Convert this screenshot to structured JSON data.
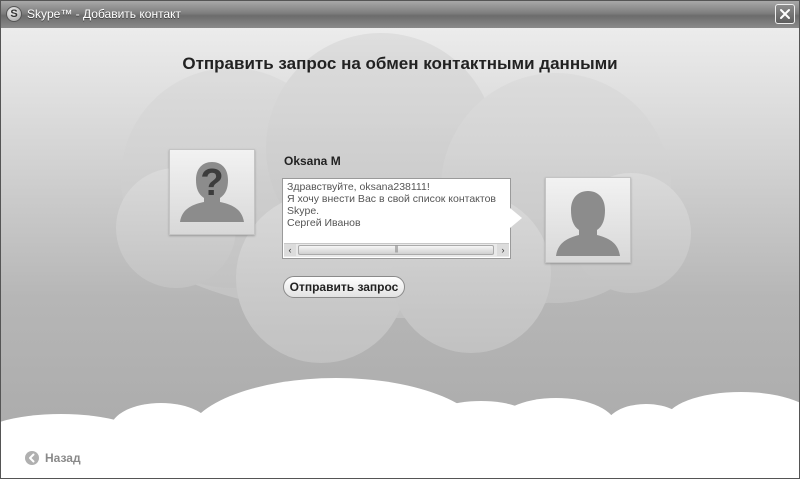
{
  "window": {
    "title": "Skype™ - Добавить контакт",
    "logo_letter": "S"
  },
  "page": {
    "heading": "Отправить запрос на обмен контактными данными"
  },
  "contact": {
    "name": "Oksana M",
    "avatar_icon": "unknown-person-icon"
  },
  "me": {
    "avatar_icon": "person-silhouette-icon"
  },
  "message": {
    "value": "Здравствуйте, oksana238111!\nЯ хочу внести Вас в свой список контактов Skype.\nСергей Иванов"
  },
  "scrollbar": {
    "left_arrow": "‹",
    "right_arrow": "›",
    "grip": "|||"
  },
  "actions": {
    "send_label": "Отправить запрос",
    "back_label": "Назад"
  }
}
